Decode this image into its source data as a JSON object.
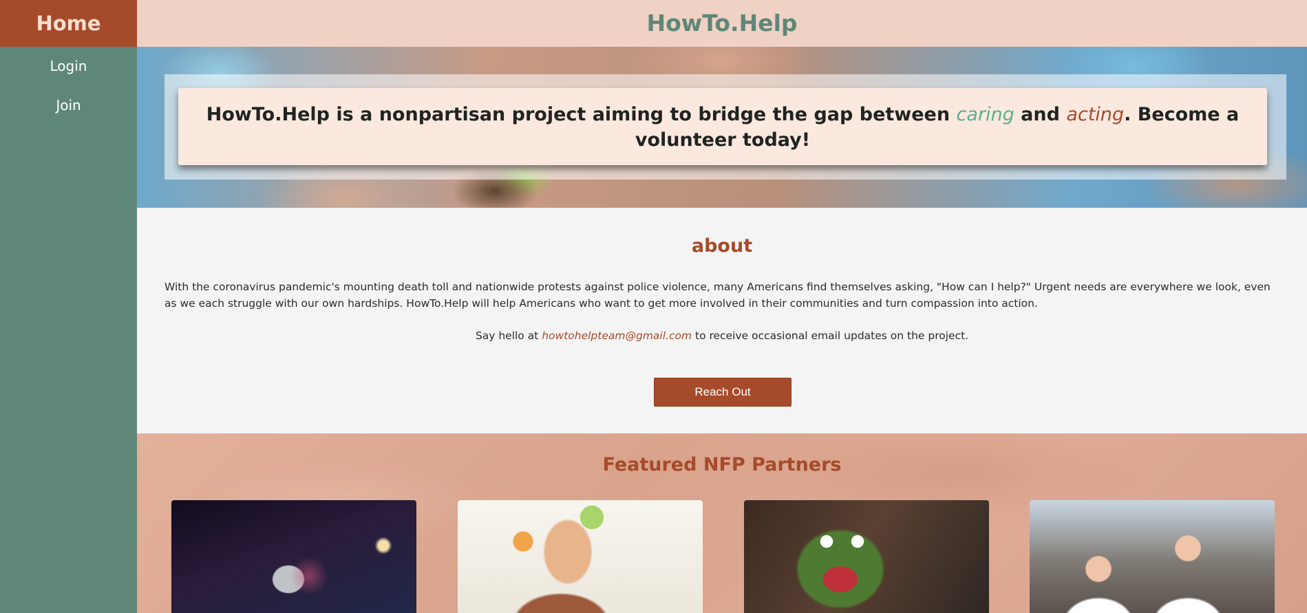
{
  "sidebar": {
    "home_label": "Home",
    "items": [
      {
        "label": "Login"
      },
      {
        "label": "Join"
      }
    ]
  },
  "header": {
    "title": "HowTo.Help"
  },
  "hero": {
    "text_before": "HowTo.Help is a nonpartisan project aiming to bridge the gap between ",
    "word_caring": "caring",
    "text_and": " and ",
    "word_acting": "acting",
    "text_after": ". Become a volunteer today!"
  },
  "about": {
    "title": "about",
    "body": "With the coronavirus pandemic's mounting death toll and nationwide protests against police violence, many Americans find themselves asking, \"How can I help?\" Urgent needs are everywhere we look, even as we each struggle with our own hardships. HowTo.Help will help Americans who want to get more involved in their communities and turn compassion into action.",
    "contact_before": "Say hello at ",
    "email": "howtohelpteam@gmail.com",
    "contact_after": " to receive occasional email updates on the project.",
    "button_label": "Reach Out"
  },
  "partners": {
    "title": "Featured NFP Partners"
  },
  "colors": {
    "brand_rust": "#a64b2a",
    "brand_green": "#5f8779",
    "accent_caring": "#5cae8e",
    "header_bg": "#efd2c4"
  }
}
